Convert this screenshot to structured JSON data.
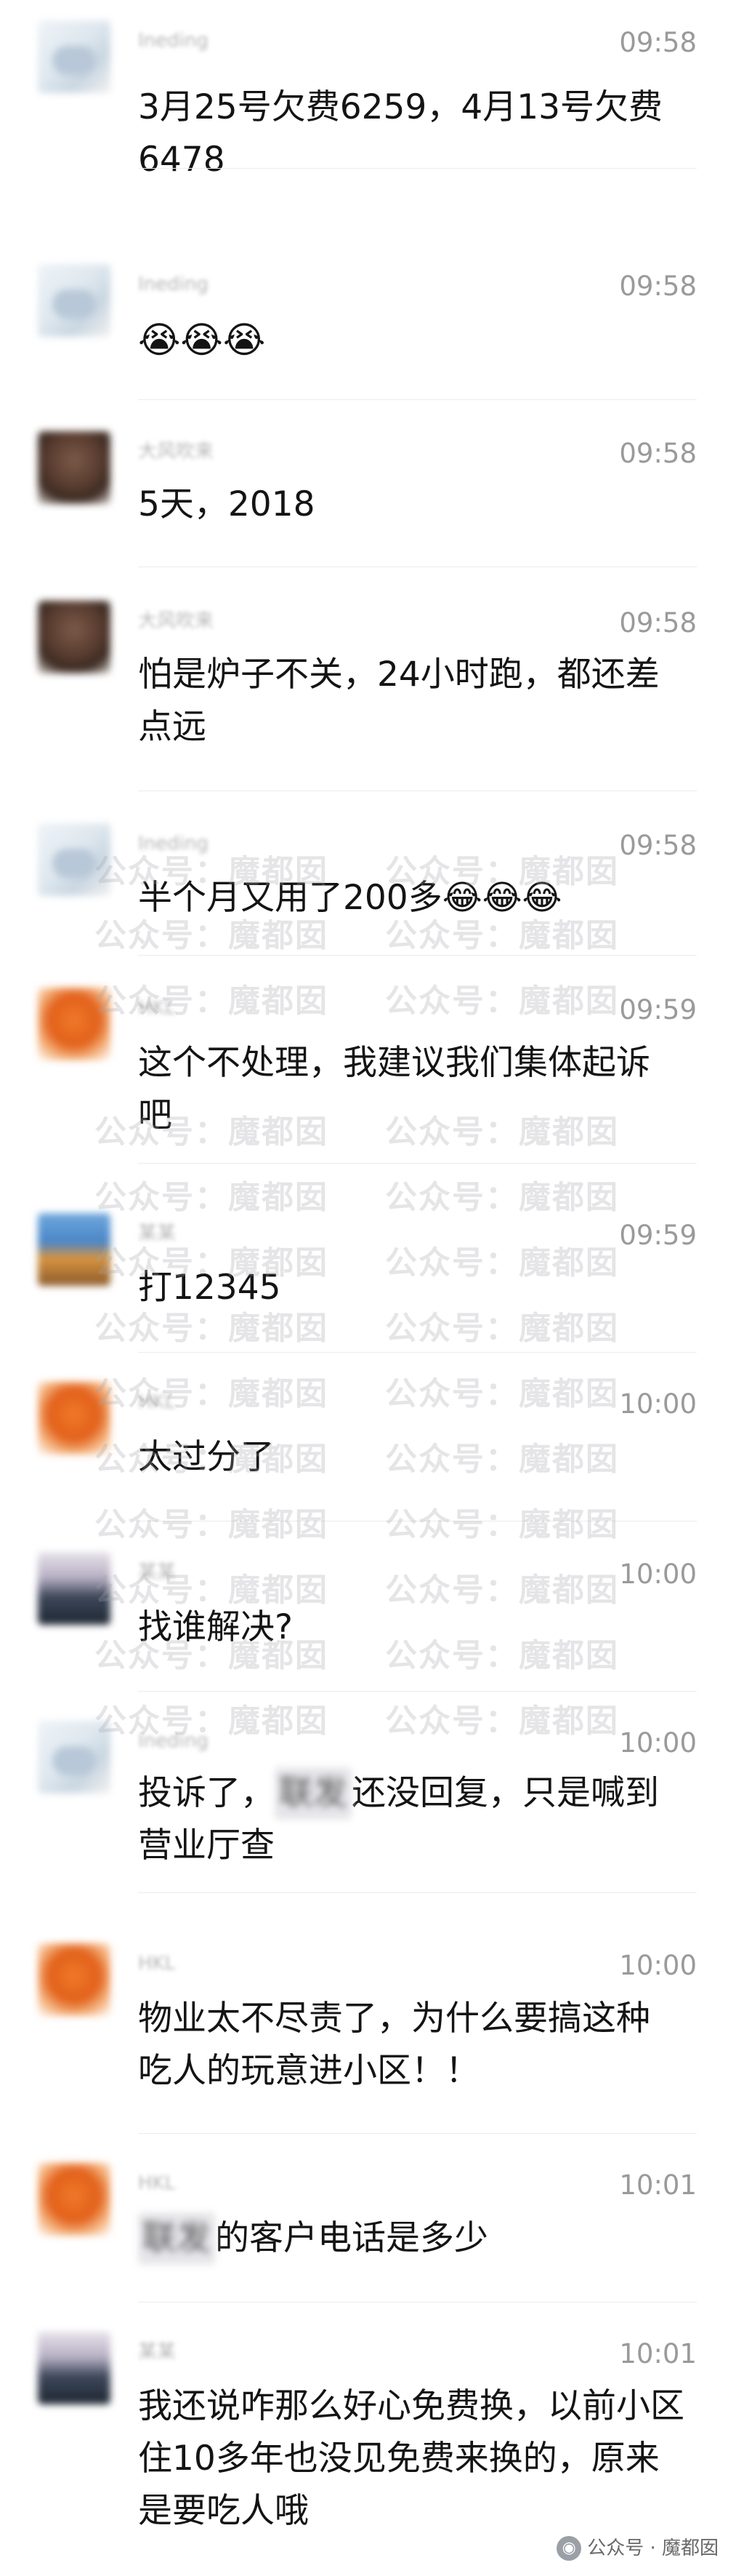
{
  "messages": [
    {
      "nickname": "Ineding",
      "time": "09:58",
      "text": "3月25号欠费6259，4月13号欠费6478",
      "avatar": "sketch-avatar"
    },
    {
      "nickname": "Ineding",
      "time": "09:58",
      "text": "😭😭😭",
      "avatar": "sketch-avatar"
    },
    {
      "nickname": "大风吹来",
      "time": "09:58",
      "text": "5天，2018",
      "avatar": "brown-avatar"
    },
    {
      "nickname": "大风吹来",
      "time": "09:58",
      "text": "怕是炉子不关，24小时跑，都还差点远",
      "avatar": "brown-avatar"
    },
    {
      "nickname": "Ineding",
      "time": "09:58",
      "text": "半个月又用了200多😂😂😂",
      "avatar": "sketch-avatar"
    },
    {
      "nickname": "HKL",
      "time": "09:59",
      "text": "这个不处理，我建议我们集体起诉吧",
      "avatar": "orange-avatar"
    },
    {
      "nickname": "某某",
      "time": "09:59",
      "text": "打12345",
      "avatar": "building-avatar"
    },
    {
      "nickname": "HKL",
      "time": "10:00",
      "text": "太过分了",
      "avatar": "orange-avatar"
    },
    {
      "nickname": "某某",
      "time": "10:00",
      "text": "找谁解决?",
      "avatar": "mountain-avatar"
    },
    {
      "nickname": "Ineding",
      "time": "10:00",
      "text_before": "投诉了，",
      "text_blurred": "联发",
      "text_after": "还没回复，只是喊到营业厅查",
      "avatar": "sketch-avatar"
    },
    {
      "nickname": "HKL",
      "time": "10:00",
      "text": "物业太不尽责了，为什么要搞这种吃人的玩意进小区！！",
      "avatar": "orange-avatar"
    },
    {
      "nickname": "HKL",
      "time": "10:01",
      "text_blurred": "联发",
      "text_after": "的客户电话是多少",
      "avatar": "orange-avatar"
    },
    {
      "nickname": "某某",
      "time": "10:01",
      "text": "我还说咋那么好心免费换，以前小区住10多年也没见免费来换的，原来是要吃人哦",
      "avatar": "mountain-avatar"
    }
  ],
  "watermark": "公众号：魔都囡",
  "footer": {
    "label": "公众号 · 魔都囡",
    "icon": "wechat-official-account-icon"
  }
}
